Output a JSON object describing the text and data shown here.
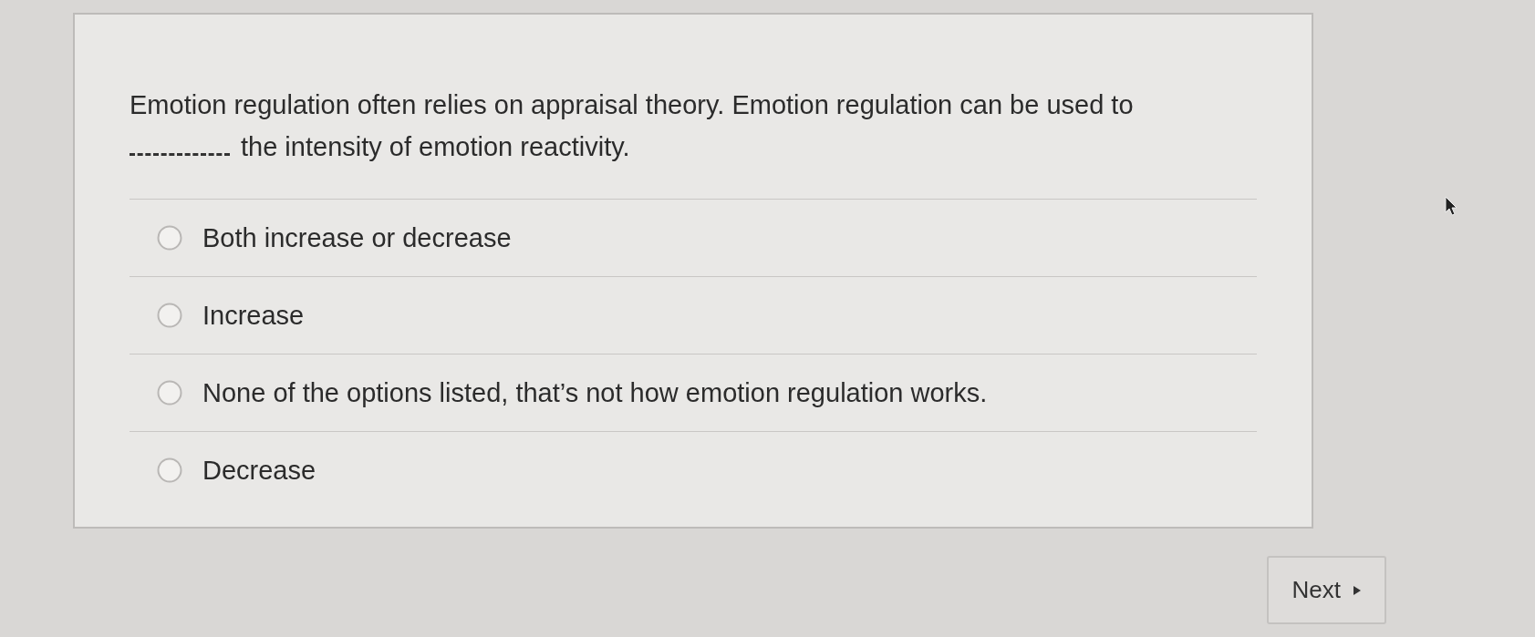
{
  "question": {
    "text_before": "Emotion regulation often relies on appraisal theory. Emotion regulation can be used to",
    "text_after": "the intensity of emotion reactivity."
  },
  "options": [
    {
      "label": "Both increase or decrease",
      "selected": false
    },
    {
      "label": "Increase",
      "selected": false
    },
    {
      "label": "None of the options listed, that’s not how emotion regulation works.",
      "selected": false
    },
    {
      "label": "Decrease",
      "selected": false
    }
  ],
  "next_button": {
    "label": "Next"
  }
}
